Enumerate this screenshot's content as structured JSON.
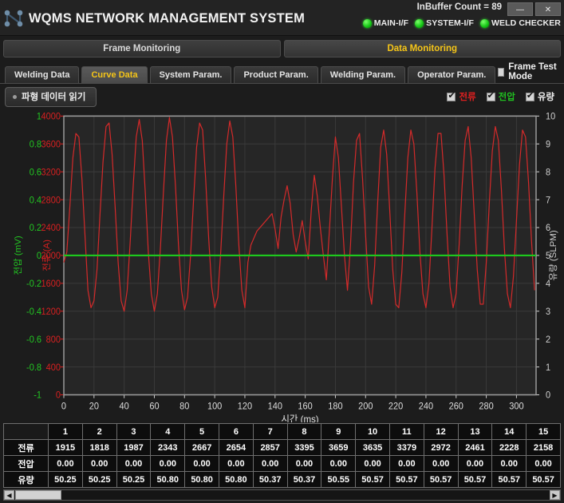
{
  "titlebar": {
    "logo_icon": "network-node-icon",
    "app_title": "WQMS NETWORK MANAGEMENT SYSTEM",
    "buffer_label": "InBuffer Count =  89",
    "minimize_label": "—",
    "close_label": "✕",
    "indicators": [
      {
        "label": "MAIN-I/F",
        "color": "#19c81a"
      },
      {
        "label": "SYSTEM-I/F",
        "color": "#19c81a"
      },
      {
        "label": "WELD CHECKER",
        "color": "#19c81a"
      }
    ]
  },
  "mode_tabs": [
    {
      "label": "Frame Monitoring",
      "active": false
    },
    {
      "label": "Data Monitoring",
      "active": true
    }
  ],
  "sub_tabs": [
    {
      "label": "Welding Data",
      "active": false
    },
    {
      "label": "Curve Data",
      "active": true
    },
    {
      "label": "System Param.",
      "active": false
    },
    {
      "label": "Product Param.",
      "active": false
    },
    {
      "label": "Welding Param.",
      "active": false
    },
    {
      "label": "Operator Param.",
      "active": false
    }
  ],
  "frame_test": {
    "label": "Frame Test Mode",
    "checked": false
  },
  "toolbar": {
    "read_button_label": "파형 데이터 읽기",
    "legend": [
      {
        "label": "전류",
        "color": "#e02020",
        "checked": true
      },
      {
        "label": "전압",
        "color": "#20c020",
        "checked": true
      },
      {
        "label": "유량",
        "color": "#f0f0f0",
        "checked": true
      }
    ]
  },
  "chart_data": {
    "type": "line",
    "title": "",
    "xlabel": "시간 (ms)",
    "xlim": [
      0,
      313
    ],
    "xticks": [
      0,
      20,
      40,
      60,
      80,
      100,
      120,
      140,
      160,
      180,
      200,
      220,
      240,
      260,
      280,
      300
    ],
    "grid": true,
    "axes": [
      {
        "name": "전압 (mV)",
        "side": "left-outer",
        "color": "#22c522",
        "lim": [
          -1,
          1
        ],
        "ticks": [
          -1,
          -0.8,
          -0.6,
          -0.4,
          -0.2,
          0,
          0.2,
          0.4,
          0.6,
          0.8,
          1
        ]
      },
      {
        "name": "전류 (A)",
        "side": "left-inner",
        "color": "#d62020",
        "lim": [
          0,
          4000
        ],
        "ticks": [
          0,
          400,
          800,
          1200,
          1600,
          2000,
          2400,
          2800,
          3200,
          3600,
          4000
        ]
      },
      {
        "name": "유량 (SLPM)",
        "side": "right",
        "color": "#cfcfcf",
        "lim": [
          0,
          10
        ],
        "ticks": [
          0,
          1,
          2,
          3,
          4,
          5,
          6,
          7,
          8,
          9,
          10
        ]
      }
    ],
    "series": [
      {
        "name": "전류",
        "color": "#d42a2a",
        "axis": "전류 (A)",
        "unit": "A",
        "description": "Oscillating welding current waveform, ~16 cycles, peaks near 3700-3950 A and troughs near 1150-1350 A, with a damped quiet interval between 100 and 132 ms",
        "points_x": [
          0,
          2,
          4,
          6,
          8,
          10,
          12,
          14,
          16,
          18,
          20,
          22,
          24,
          26,
          28,
          30,
          32,
          34,
          36,
          38,
          40,
          42,
          44,
          46,
          48,
          50,
          52,
          54,
          56,
          58,
          60,
          62,
          64,
          66,
          68,
          70,
          72,
          74,
          76,
          78,
          80,
          82,
          84,
          86,
          88,
          90,
          92,
          94,
          96,
          98,
          100,
          102,
          104,
          106,
          108,
          110,
          112,
          114,
          116,
          118,
          120,
          122,
          124,
          126,
          128,
          130,
          132,
          134,
          136,
          138,
          140,
          142,
          144,
          146,
          148,
          150,
          152,
          154,
          156,
          158,
          160,
          162,
          164,
          166,
          168,
          170,
          172,
          174,
          176,
          178,
          180,
          182,
          184,
          186,
          188,
          190,
          192,
          194,
          196,
          198,
          200,
          202,
          204,
          206,
          208,
          210,
          212,
          214,
          216,
          218,
          220,
          222,
          224,
          226,
          228,
          230,
          232,
          234,
          236,
          238,
          240,
          242,
          244,
          246,
          248,
          250,
          252,
          254,
          256,
          258,
          260,
          262,
          264,
          266,
          268,
          270,
          272,
          274,
          276,
          278,
          280,
          282,
          284,
          286,
          288,
          290,
          292,
          294,
          296,
          298,
          300,
          302,
          304,
          306,
          308,
          310,
          312
        ],
        "points_y": [
          1900,
          2050,
          2700,
          3400,
          3750,
          3700,
          3100,
          2300,
          1500,
          1250,
          1350,
          1800,
          2600,
          3350,
          3850,
          3900,
          3450,
          2700,
          1900,
          1350,
          1200,
          1500,
          2200,
          3000,
          3700,
          3950,
          3650,
          2900,
          2050,
          1450,
          1200,
          1450,
          2100,
          2900,
          3650,
          3980,
          3700,
          3000,
          2150,
          1500,
          1220,
          1400,
          2000,
          2800,
          3550,
          3900,
          3800,
          3100,
          2250,
          1550,
          1250,
          1400,
          2050,
          2850,
          3600,
          3930,
          3700,
          3000,
          2150,
          1500,
          1250,
          1900,
          2150,
          2250,
          2350,
          2400,
          2450,
          2500,
          2550,
          2600,
          2380,
          2100,
          2550,
          2800,
          3000,
          2750,
          2300,
          2050,
          2250,
          2500,
          2200,
          1950,
          2650,
          3150,
          2850,
          2400,
          2000,
          1650,
          2350,
          3100,
          3700,
          3400,
          2700,
          2000,
          1500,
          2150,
          3050,
          3650,
          3750,
          3100,
          2300,
          1550,
          1300,
          1850,
          2750,
          3550,
          3800,
          3450,
          2650,
          1800,
          1300,
          1250,
          1750,
          2600,
          3400,
          3800,
          3600,
          2900,
          2050,
          1450,
          1250,
          1600,
          2400,
          3250,
          3750,
          3750,
          3150,
          2300,
          1550,
          1250,
          1450,
          2150,
          3000,
          3650,
          3850,
          3400,
          2600,
          1800,
          1300,
          1300,
          1900,
          2750,
          3500,
          3850,
          3650,
          2950,
          2100,
          1450,
          1250,
          1700,
          2500,
          3300,
          3800,
          3700,
          3050,
          2200,
          1500,
          1250,
          1550,
          2300
        ]
      },
      {
        "name": "전압",
        "color": "#1ec81e",
        "axis": "전압 (mV)",
        "unit": "mV",
        "description": "Flat voltage trace at 0.00 mV (drawn at the 2000 A / 5 SLPM mid-scale line)",
        "constant_value": 0.0
      }
    ]
  },
  "table": {
    "corner_label": "",
    "columns": [
      "1",
      "2",
      "3",
      "4",
      "5",
      "6",
      "7",
      "8",
      "9",
      "10",
      "11",
      "12",
      "13",
      "14",
      "15"
    ],
    "rows": [
      {
        "label": "전류",
        "values": [
          "1915",
          "1818",
          "1987",
          "2343",
          "2667",
          "2654",
          "2857",
          "3395",
          "3659",
          "3635",
          "3379",
          "2972",
          "2461",
          "2228",
          "2158"
        ]
      },
      {
        "label": "전압",
        "values": [
          "0.00",
          "0.00",
          "0.00",
          "0.00",
          "0.00",
          "0.00",
          "0.00",
          "0.00",
          "0.00",
          "0.00",
          "0.00",
          "0.00",
          "0.00",
          "0.00",
          "0.00"
        ]
      },
      {
        "label": "유량",
        "values": [
          "50.25",
          "50.25",
          "50.25",
          "50.80",
          "50.80",
          "50.80",
          "50.37",
          "50.37",
          "50.55",
          "50.57",
          "50.57",
          "50.57",
          "50.57",
          "50.57",
          "50.57"
        ]
      }
    ],
    "scroll_left_icon": "◀",
    "scroll_right_icon": "▶"
  }
}
